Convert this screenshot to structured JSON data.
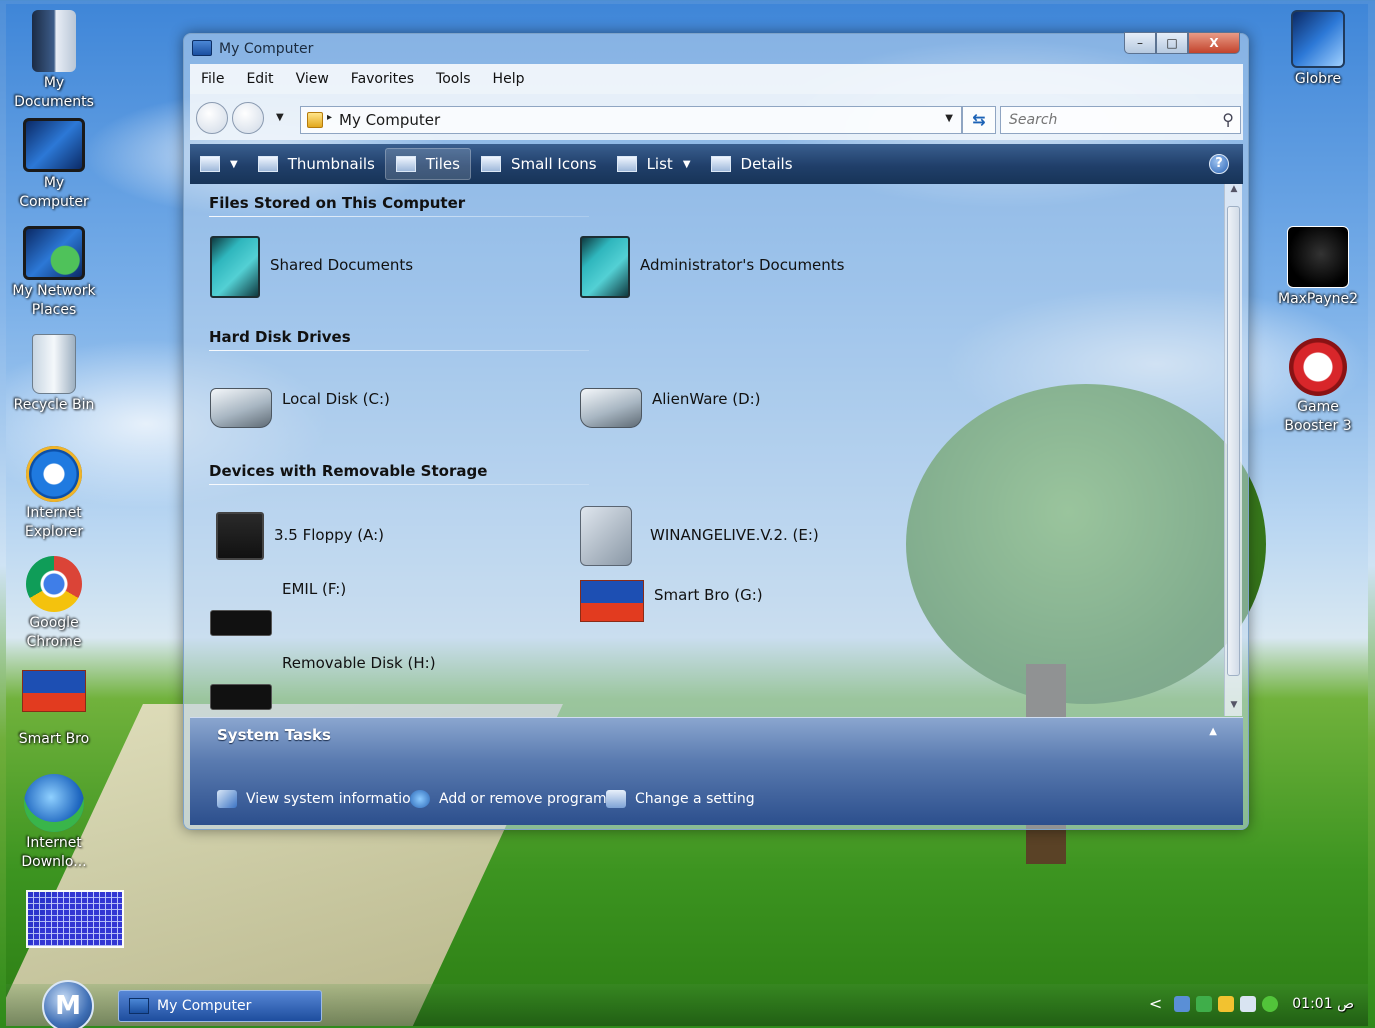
{
  "desktop": {
    "icons_left": [
      {
        "label_line1": "My",
        "label_line2": "Documents",
        "icon": "my-documents-icon"
      },
      {
        "label_line1": "My",
        "label_line2": "Computer",
        "icon": "my-computer-icon"
      },
      {
        "label_line1": "My Network",
        "label_line2": "Places",
        "icon": "network-places-icon"
      },
      {
        "label_line1": "Recycle Bin",
        "label_line2": "",
        "icon": "recycle-bin-icon"
      },
      {
        "label_line1": "Internet",
        "label_line2": "Explorer",
        "icon": "internet-explorer-icon"
      },
      {
        "label_line1": "Google",
        "label_line2": "Chrome",
        "icon": "google-chrome-icon"
      },
      {
        "label_line1": "Smart Bro",
        "label_line2": "",
        "icon": "smart-bro-icon"
      },
      {
        "label_line1": "Internet",
        "label_line2": "Downlo...",
        "icon": "internet-download-manager-icon"
      }
    ],
    "icons_right": [
      {
        "label_line1": "Globre",
        "label_line2": "",
        "icon": "globre-icon"
      },
      {
        "label_line1": "MaxPayne2",
        "label_line2": "",
        "icon": "maxpayne2-icon"
      },
      {
        "label_line1": "Game",
        "label_line2": "Booster 3",
        "icon": "game-booster-icon"
      }
    ]
  },
  "window": {
    "title": "My Computer",
    "caption_buttons": {
      "minimize": "–",
      "maximize": "□",
      "close": "X"
    },
    "menu": [
      "File",
      "Edit",
      "View",
      "Favorites",
      "Tools",
      "Help"
    ],
    "address": {
      "path": "My Computer"
    },
    "search": {
      "placeholder": "Search"
    },
    "toolbar": {
      "thumbnails": "Thumbnails",
      "tiles": "Tiles",
      "small_icons": "Small Icons",
      "list": "List",
      "details": "Details",
      "help": "?"
    },
    "groups": [
      {
        "heading": "Files Stored on This Computer",
        "items": [
          "Shared Documents",
          "Administrator's Documents"
        ]
      },
      {
        "heading": "Hard Disk Drives",
        "items": [
          "Local Disk (C:)",
          "AlienWare (D:)"
        ]
      },
      {
        "heading": "Devices with Removable Storage",
        "items": [
          "3.5 Floppy (A:)",
          "WINANGELIVE.V.2. (E:)",
          "EMIL (F:)",
          "Smart Bro (G:)",
          "Removable Disk (H:)"
        ]
      }
    ],
    "system_tasks": {
      "heading": "System Tasks",
      "tasks": [
        "View system information",
        "Add or remove programs",
        "Change a setting"
      ]
    }
  },
  "taskbar": {
    "start_label": "M",
    "active_window": "My Computer",
    "clock": "01:01 ص"
  },
  "colors": {
    "toolbar": "#203f6a",
    "tasks_panel": "#2c4f8d",
    "taskbar_button": "#1d4d9e"
  }
}
